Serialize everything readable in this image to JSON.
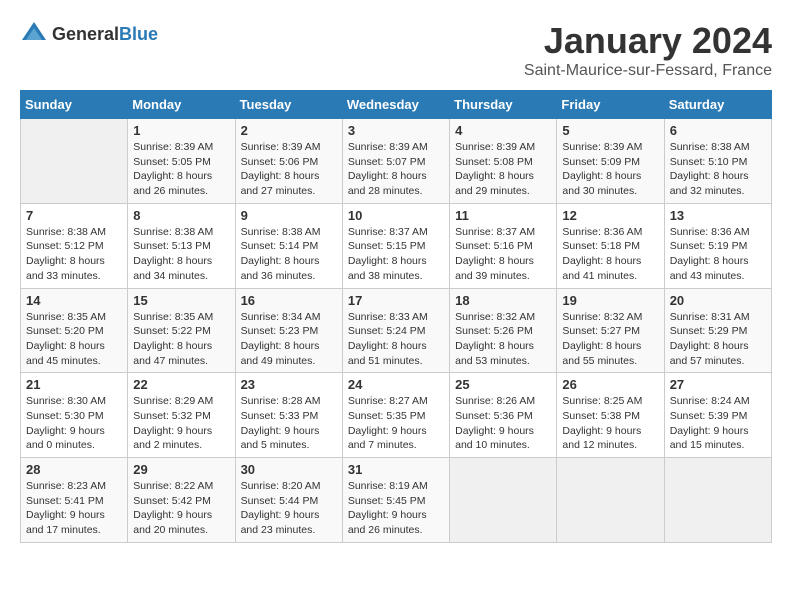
{
  "logo": {
    "text_general": "General",
    "text_blue": "Blue"
  },
  "title": "January 2024",
  "location": "Saint-Maurice-sur-Fessard, France",
  "days_of_week": [
    "Sunday",
    "Monday",
    "Tuesday",
    "Wednesday",
    "Thursday",
    "Friday",
    "Saturday"
  ],
  "weeks": [
    [
      {
        "day": "",
        "sunrise": "",
        "sunset": "",
        "daylight": ""
      },
      {
        "day": "1",
        "sunrise": "Sunrise: 8:39 AM",
        "sunset": "Sunset: 5:05 PM",
        "daylight": "Daylight: 8 hours and 26 minutes."
      },
      {
        "day": "2",
        "sunrise": "Sunrise: 8:39 AM",
        "sunset": "Sunset: 5:06 PM",
        "daylight": "Daylight: 8 hours and 27 minutes."
      },
      {
        "day": "3",
        "sunrise": "Sunrise: 8:39 AM",
        "sunset": "Sunset: 5:07 PM",
        "daylight": "Daylight: 8 hours and 28 minutes."
      },
      {
        "day": "4",
        "sunrise": "Sunrise: 8:39 AM",
        "sunset": "Sunset: 5:08 PM",
        "daylight": "Daylight: 8 hours and 29 minutes."
      },
      {
        "day": "5",
        "sunrise": "Sunrise: 8:39 AM",
        "sunset": "Sunset: 5:09 PM",
        "daylight": "Daylight: 8 hours and 30 minutes."
      },
      {
        "day": "6",
        "sunrise": "Sunrise: 8:38 AM",
        "sunset": "Sunset: 5:10 PM",
        "daylight": "Daylight: 8 hours and 32 minutes."
      }
    ],
    [
      {
        "day": "7",
        "sunrise": "Sunrise: 8:38 AM",
        "sunset": "Sunset: 5:12 PM",
        "daylight": "Daylight: 8 hours and 33 minutes."
      },
      {
        "day": "8",
        "sunrise": "Sunrise: 8:38 AM",
        "sunset": "Sunset: 5:13 PM",
        "daylight": "Daylight: 8 hours and 34 minutes."
      },
      {
        "day": "9",
        "sunrise": "Sunrise: 8:38 AM",
        "sunset": "Sunset: 5:14 PM",
        "daylight": "Daylight: 8 hours and 36 minutes."
      },
      {
        "day": "10",
        "sunrise": "Sunrise: 8:37 AM",
        "sunset": "Sunset: 5:15 PM",
        "daylight": "Daylight: 8 hours and 38 minutes."
      },
      {
        "day": "11",
        "sunrise": "Sunrise: 8:37 AM",
        "sunset": "Sunset: 5:16 PM",
        "daylight": "Daylight: 8 hours and 39 minutes."
      },
      {
        "day": "12",
        "sunrise": "Sunrise: 8:36 AM",
        "sunset": "Sunset: 5:18 PM",
        "daylight": "Daylight: 8 hours and 41 minutes."
      },
      {
        "day": "13",
        "sunrise": "Sunrise: 8:36 AM",
        "sunset": "Sunset: 5:19 PM",
        "daylight": "Daylight: 8 hours and 43 minutes."
      }
    ],
    [
      {
        "day": "14",
        "sunrise": "Sunrise: 8:35 AM",
        "sunset": "Sunset: 5:20 PM",
        "daylight": "Daylight: 8 hours and 45 minutes."
      },
      {
        "day": "15",
        "sunrise": "Sunrise: 8:35 AM",
        "sunset": "Sunset: 5:22 PM",
        "daylight": "Daylight: 8 hours and 47 minutes."
      },
      {
        "day": "16",
        "sunrise": "Sunrise: 8:34 AM",
        "sunset": "Sunset: 5:23 PM",
        "daylight": "Daylight: 8 hours and 49 minutes."
      },
      {
        "day": "17",
        "sunrise": "Sunrise: 8:33 AM",
        "sunset": "Sunset: 5:24 PM",
        "daylight": "Daylight: 8 hours and 51 minutes."
      },
      {
        "day": "18",
        "sunrise": "Sunrise: 8:32 AM",
        "sunset": "Sunset: 5:26 PM",
        "daylight": "Daylight: 8 hours and 53 minutes."
      },
      {
        "day": "19",
        "sunrise": "Sunrise: 8:32 AM",
        "sunset": "Sunset: 5:27 PM",
        "daylight": "Daylight: 8 hours and 55 minutes."
      },
      {
        "day": "20",
        "sunrise": "Sunrise: 8:31 AM",
        "sunset": "Sunset: 5:29 PM",
        "daylight": "Daylight: 8 hours and 57 minutes."
      }
    ],
    [
      {
        "day": "21",
        "sunrise": "Sunrise: 8:30 AM",
        "sunset": "Sunset: 5:30 PM",
        "daylight": "Daylight: 9 hours and 0 minutes."
      },
      {
        "day": "22",
        "sunrise": "Sunrise: 8:29 AM",
        "sunset": "Sunset: 5:32 PM",
        "daylight": "Daylight: 9 hours and 2 minutes."
      },
      {
        "day": "23",
        "sunrise": "Sunrise: 8:28 AM",
        "sunset": "Sunset: 5:33 PM",
        "daylight": "Daylight: 9 hours and 5 minutes."
      },
      {
        "day": "24",
        "sunrise": "Sunrise: 8:27 AM",
        "sunset": "Sunset: 5:35 PM",
        "daylight": "Daylight: 9 hours and 7 minutes."
      },
      {
        "day": "25",
        "sunrise": "Sunrise: 8:26 AM",
        "sunset": "Sunset: 5:36 PM",
        "daylight": "Daylight: 9 hours and 10 minutes."
      },
      {
        "day": "26",
        "sunrise": "Sunrise: 8:25 AM",
        "sunset": "Sunset: 5:38 PM",
        "daylight": "Daylight: 9 hours and 12 minutes."
      },
      {
        "day": "27",
        "sunrise": "Sunrise: 8:24 AM",
        "sunset": "Sunset: 5:39 PM",
        "daylight": "Daylight: 9 hours and 15 minutes."
      }
    ],
    [
      {
        "day": "28",
        "sunrise": "Sunrise: 8:23 AM",
        "sunset": "Sunset: 5:41 PM",
        "daylight": "Daylight: 9 hours and 17 minutes."
      },
      {
        "day": "29",
        "sunrise": "Sunrise: 8:22 AM",
        "sunset": "Sunset: 5:42 PM",
        "daylight": "Daylight: 9 hours and 20 minutes."
      },
      {
        "day": "30",
        "sunrise": "Sunrise: 8:20 AM",
        "sunset": "Sunset: 5:44 PM",
        "daylight": "Daylight: 9 hours and 23 minutes."
      },
      {
        "day": "31",
        "sunrise": "Sunrise: 8:19 AM",
        "sunset": "Sunset: 5:45 PM",
        "daylight": "Daylight: 9 hours and 26 minutes."
      },
      {
        "day": "",
        "sunrise": "",
        "sunset": "",
        "daylight": ""
      },
      {
        "day": "",
        "sunrise": "",
        "sunset": "",
        "daylight": ""
      },
      {
        "day": "",
        "sunrise": "",
        "sunset": "",
        "daylight": ""
      }
    ]
  ]
}
